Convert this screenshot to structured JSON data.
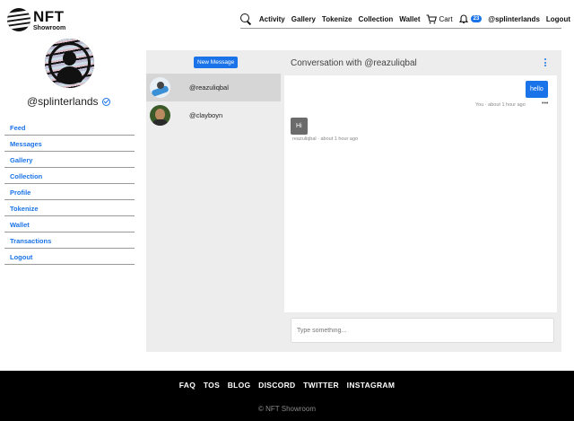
{
  "brand": {
    "name": "NFT",
    "sub": "Showroom"
  },
  "nav": {
    "items": [
      "Activity",
      "Gallery",
      "Tokenize",
      "Collection",
      "Wallet"
    ],
    "cart": "Cart",
    "notifications": "23",
    "user": "@splinterlands",
    "logout": "Logout"
  },
  "profile": {
    "username": "@splinterlands"
  },
  "sidebar": {
    "items": [
      "Feed",
      "Messages",
      "Gallery",
      "Collection",
      "Profile",
      "Tokenize",
      "Wallet",
      "Transactions",
      "Logout"
    ]
  },
  "messages": {
    "new_button": "New Message",
    "conversations": [
      {
        "name": "@reazuliqbal",
        "active": true
      },
      {
        "name": "@clayboyn",
        "active": false
      }
    ],
    "title": "Conversation with @reazuliqbal",
    "thread": [
      {
        "text": "hello",
        "meta": "You · about 1 hour ago",
        "dir": "out"
      },
      {
        "text": "Hi",
        "meta": "reazuliqbal · about 1 hour ago",
        "dir": "in"
      }
    ],
    "composer_placeholder": "Type something..."
  },
  "footer": {
    "links": [
      "FAQ",
      "TOS",
      "BLOG",
      "DISCORD",
      "TWITTER",
      "INSTAGRAM"
    ],
    "copyright": "© NFT Showroom"
  },
  "colors": {
    "accent": "#1a73e8",
    "footer_bg": "#000000",
    "panel_bg": "#ededed"
  }
}
